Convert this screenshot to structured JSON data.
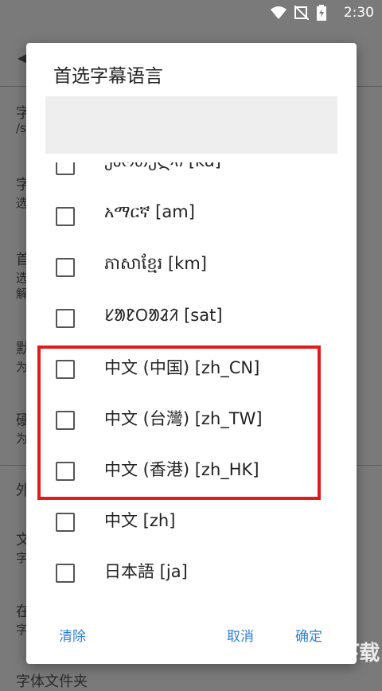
{
  "status_bar": {
    "time": "2:30"
  },
  "background": {
    "rows": [
      "字",
      "/s",
      "字",
      "选",
      "首",
      "选",
      "解",
      "默",
      "为",
      "硬",
      "为",
      "外",
      "文",
      "字",
      "在",
      "字",
      "字体文件夹"
    ]
  },
  "dialog": {
    "title": "首选字幕语言",
    "search_value": "",
    "items": [
      "ქართული [ka]",
      "አማርኛ [am]",
      "ភាសាខ្មែរ [km]",
      "ᱥᱟᱱᱛᱟᱲᱤ [sat]",
      "中文 (中国) [zh_CN]",
      "中文 (台灣) [zh_TW]",
      "中文 (香港) [zh_HK]",
      "中文 [zh]",
      "日本語 [ja]"
    ],
    "clear_label": "清除",
    "cancel_label": "取消",
    "ok_label": "确定"
  },
  "watermark": "KK下载",
  "colors": {
    "accent": "#2f7fd8",
    "highlight": "#e01b1b",
    "scrim": "#7a7a7a"
  }
}
